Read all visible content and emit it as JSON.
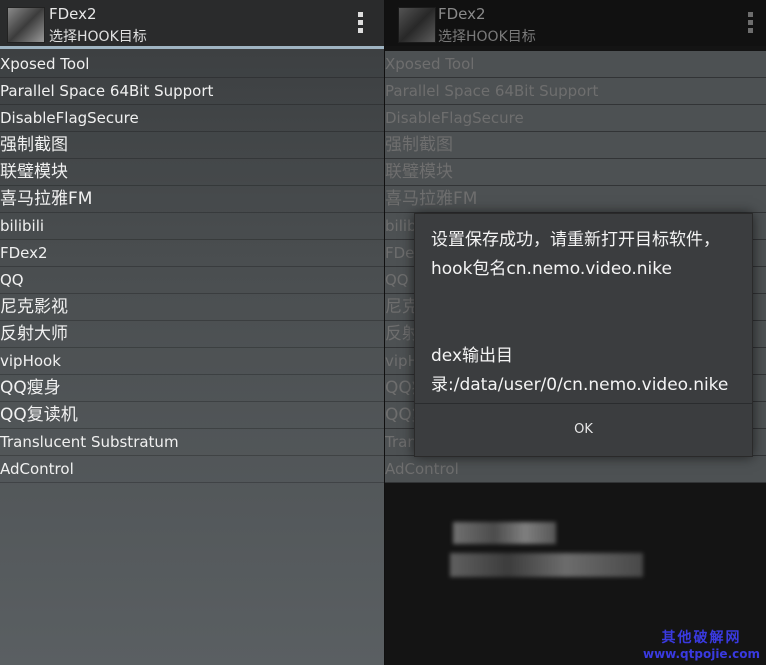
{
  "left": {
    "actionbar": {
      "title": "FDex2",
      "subtitle": "选择HOOK目标",
      "menu_icon": "overflow-menu-icon"
    },
    "list": [
      "Xposed Tool",
      "Parallel Space 64Bit Support",
      "DisableFlagSecure",
      "强制截图",
      "联璧模块",
      "喜马拉雅FM",
      "bilibili",
      "FDex2",
      "QQ",
      "尼克影视",
      "反射大师",
      "vipHook",
      "QQ瘦身",
      "QQ复读机",
      "Translucent Substratum",
      "AdControl"
    ]
  },
  "right": {
    "actionbar": {
      "title": "FDex2",
      "subtitle": "选择HOOK目标"
    },
    "list": [
      "Xposed Tool",
      "Parallel Space 64Bit Support",
      "DisableFlagSecure",
      "强制截图",
      "联璧模块",
      "喜马拉雅FM",
      "bilibili",
      "FDex2",
      "QQ",
      "尼克影视",
      "反射大师",
      "vipHook",
      "QQ瘦身",
      "QQ复读机",
      "Translucent Substratum",
      "AdControl"
    ]
  },
  "dialog": {
    "message_line1": "设置保存成功，请重新打开目标软件，hook包名cn.nemo.video.nike",
    "message_line2": "dex输出目录:/data/user/0/cn.nemo.video.nike",
    "ok_label": "OK"
  },
  "watermark": {
    "line1": "其他破解网",
    "line2": "www.qtpojie.com"
  },
  "colors": {
    "accent": "#9fb4c2",
    "watermark": "#3a3ae0",
    "dialog_bg": "#3b3d3f"
  }
}
